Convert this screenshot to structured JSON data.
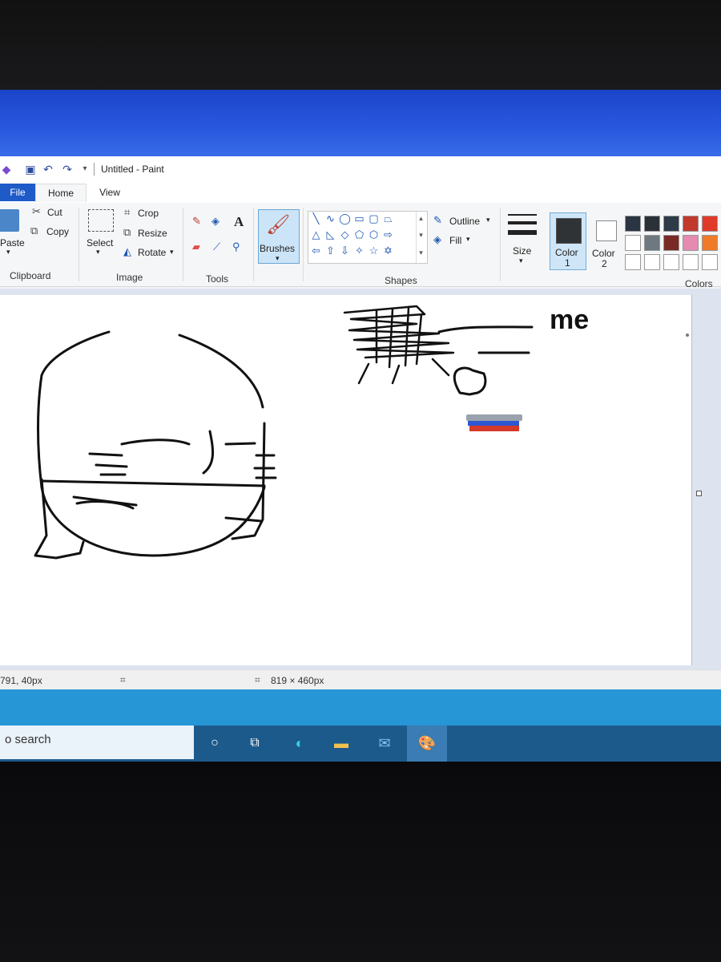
{
  "window": {
    "title": "Untitled - Paint"
  },
  "tabs": [
    {
      "label": "File"
    },
    {
      "label": "Home"
    },
    {
      "label": "View"
    }
  ],
  "ribbon": {
    "clipboard": {
      "label": "Clipboard",
      "paste": "Paste",
      "cut": "Cut",
      "copy": "Copy"
    },
    "image": {
      "label": "Image",
      "select": "Select",
      "crop": "Crop",
      "resize": "Resize",
      "rotate": "Rotate"
    },
    "tools": {
      "label": "Tools",
      "text_tool": "A"
    },
    "brushes": {
      "label": "Brushes"
    },
    "shapes": {
      "label": "Shapes",
      "outline": "Outline",
      "fill": "Fill"
    },
    "size": {
      "label": "Size"
    },
    "color1": {
      "label": "Color",
      "num": "1",
      "value": "#2f3336"
    },
    "color2": {
      "label": "Color",
      "num": "2",
      "value": "#ffffff"
    },
    "colors": {
      "label": "Colors",
      "palette": [
        "#2b3442",
        "#2a3137",
        "#2d3a48",
        "#c0392b",
        "#e03a2b",
        "#ffffff",
        "#6e7880",
        "#7a2a24",
        "#e58ab0",
        "#f07a28",
        "#ffffff",
        "#ffffff",
        "#ffffff",
        "#ffffff",
        "#ffffff"
      ]
    }
  },
  "canvas": {
    "drawing_text": "me",
    "stripe_colors": [
      "#9aa2ad",
      "#2d57d2",
      "#d43a2a"
    ]
  },
  "status": {
    "cursor_pos": "791, 40px",
    "image_size": "819 × 460px"
  },
  "taskbar": {
    "search": "o search"
  }
}
